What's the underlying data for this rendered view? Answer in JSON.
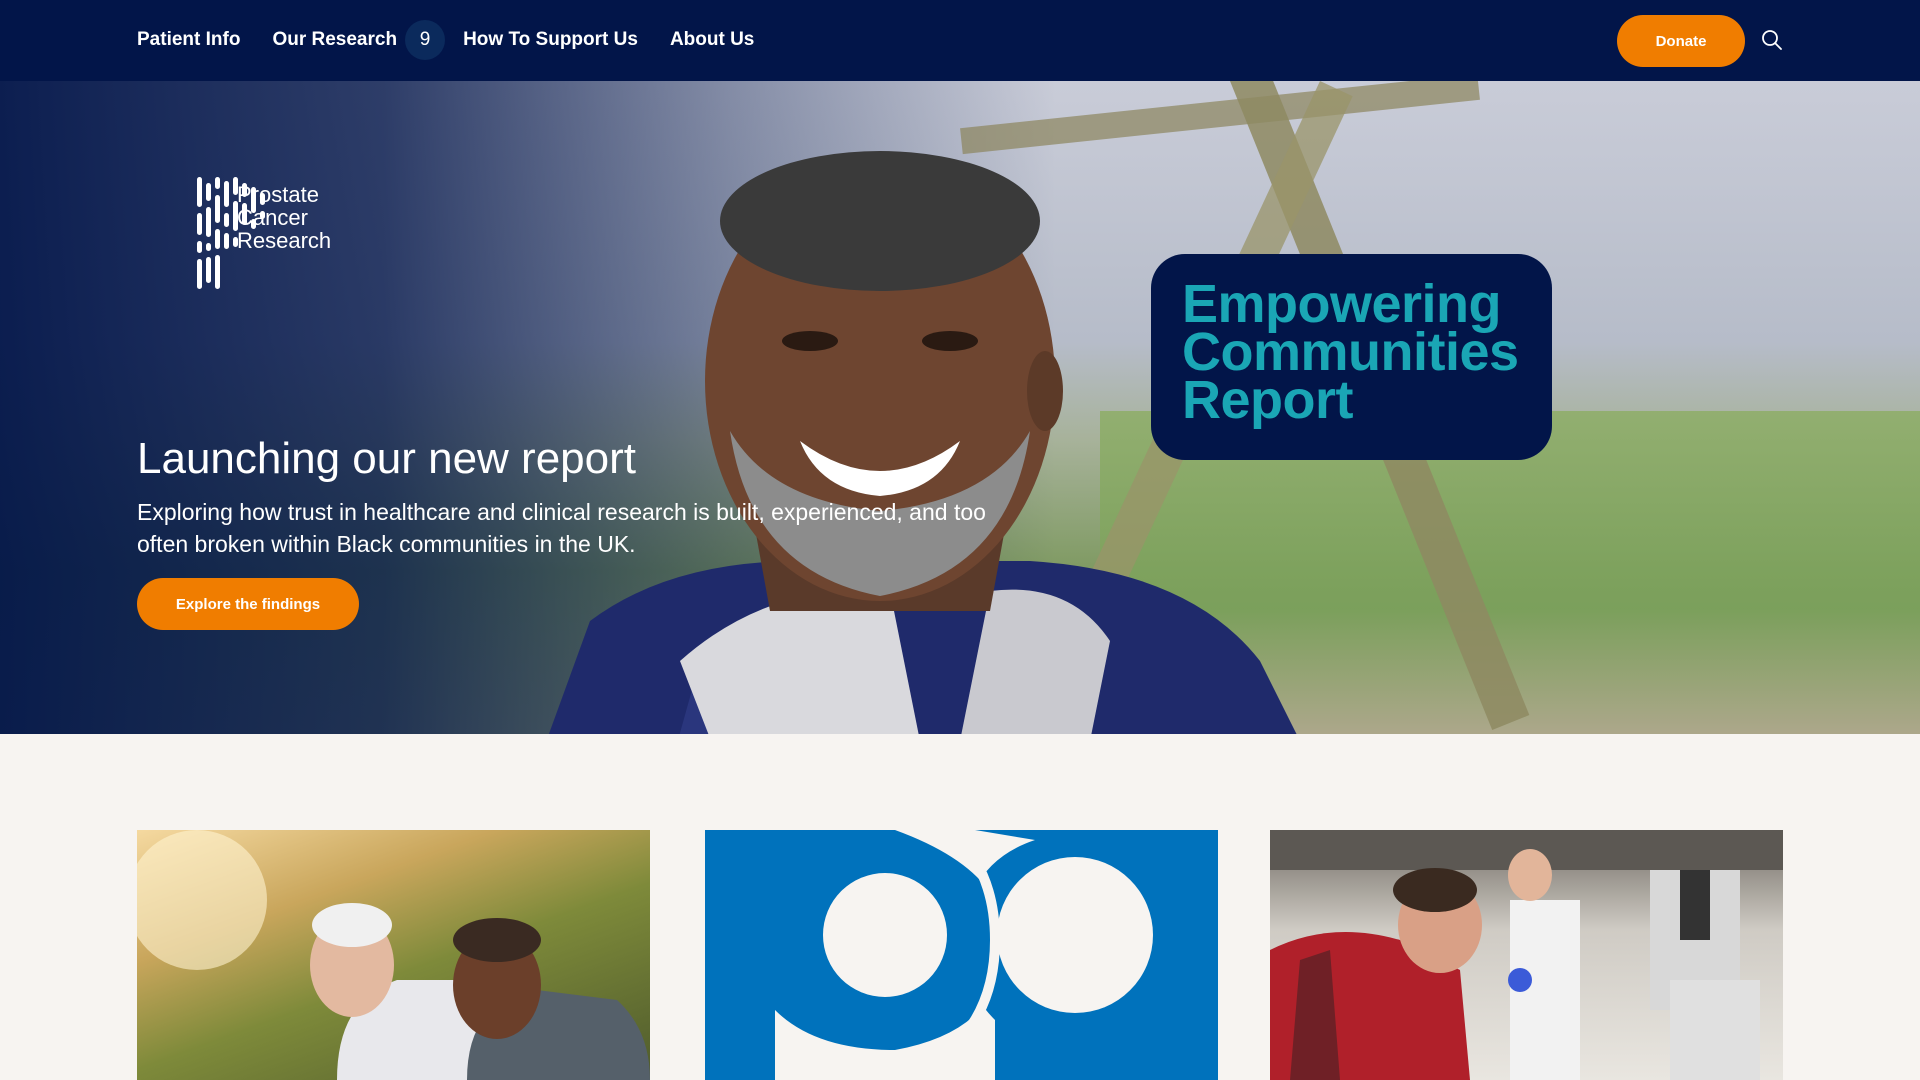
{
  "nav": {
    "links": [
      "Patient Info",
      "Our Research",
      "How To Support Us",
      "About Us"
    ],
    "badge": "9",
    "donate_label": "Donate",
    "search_icon": "search-icon"
  },
  "logo": {
    "lines": [
      "Prostate",
      "Cancer",
      "Research"
    ]
  },
  "hero": {
    "title": "Launching our new report",
    "subtitle": "Exploring how trust in healthcare and clinical research is built, experienced, and too often broken within Black communities in the UK.",
    "cta_label": "Explore the findings",
    "badge_lines": [
      "Empowering",
      "Communities",
      "Report"
    ]
  },
  "colors": {
    "navy": "#021549",
    "orange": "#f07d00",
    "teal": "#1aa6b5",
    "brand_blue": "#0072bc",
    "page_bg": "#f7f4f1"
  },
  "cards": [
    {
      "image": "two-smiling-men-photo"
    },
    {
      "image": "blue-brand-logo-graphic"
    },
    {
      "image": "lab-scientist-microscope-photo"
    }
  ]
}
